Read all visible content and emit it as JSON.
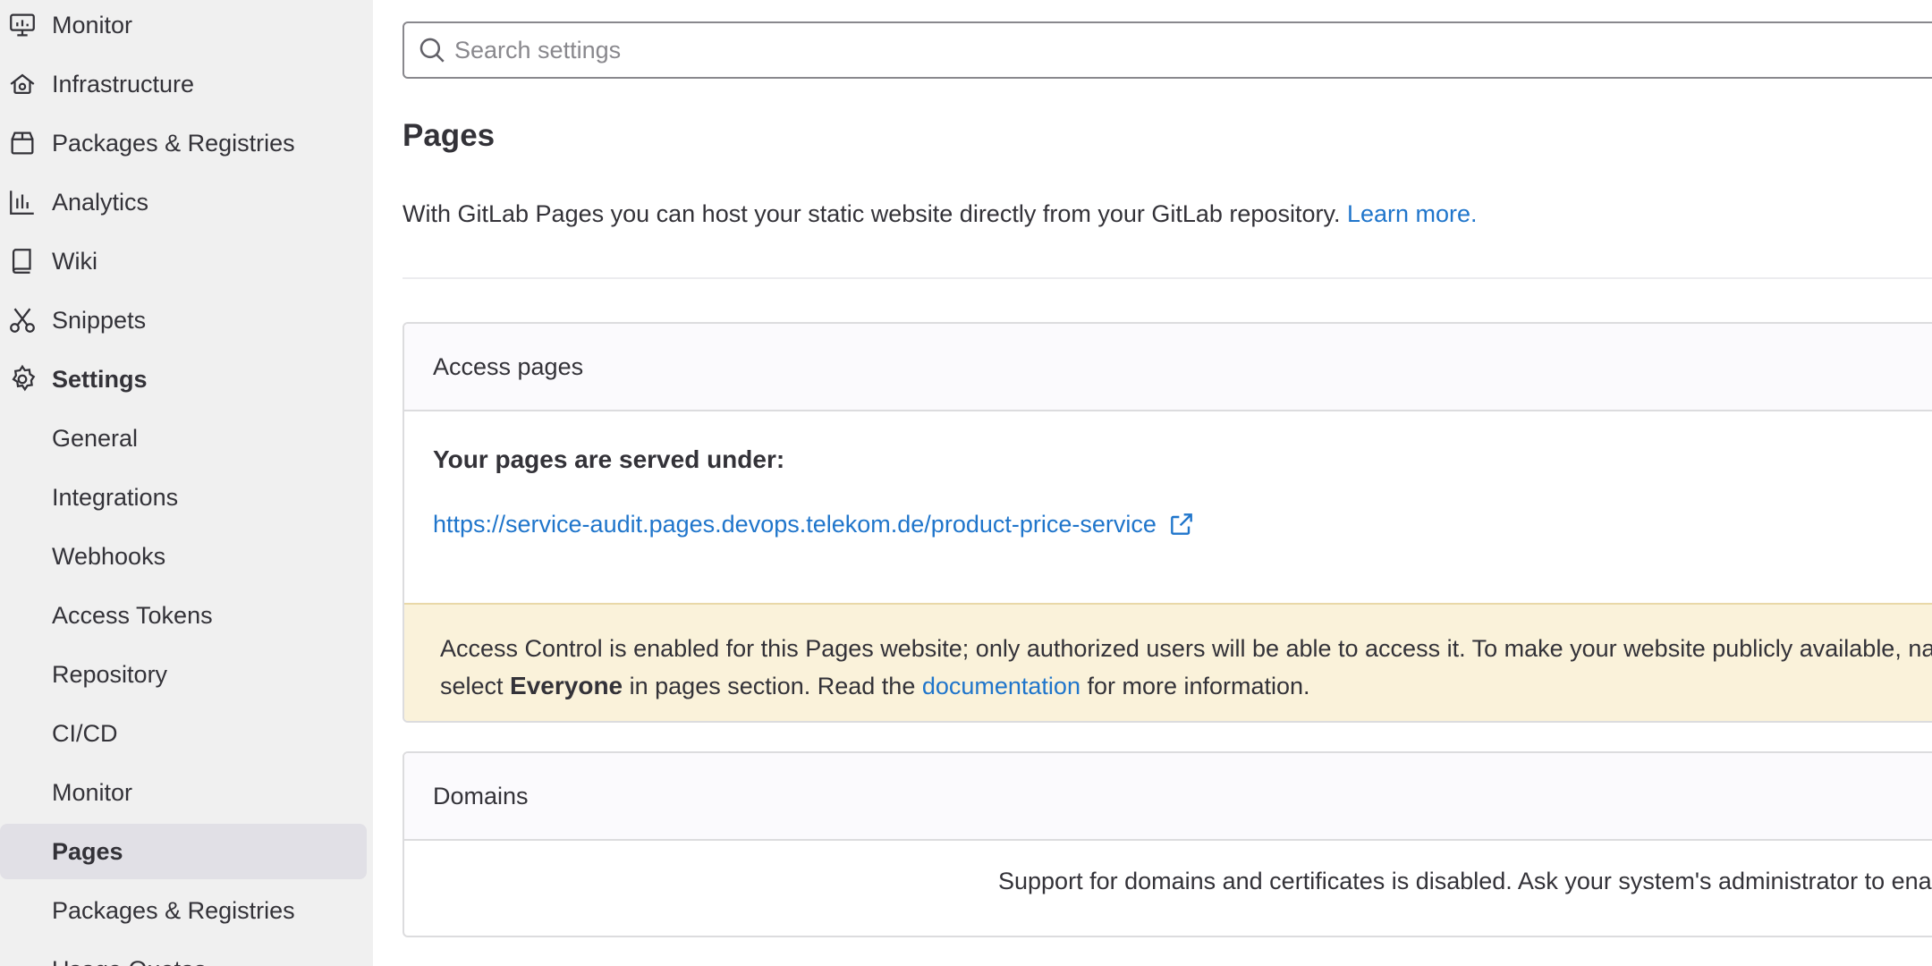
{
  "sidebar": {
    "items": [
      {
        "label": "Monitor",
        "icon": "monitor-icon",
        "top": 0
      },
      {
        "label": "Infrastructure",
        "icon": "infrastructure-icon"
      },
      {
        "label": "Packages & Registries",
        "icon": "package-icon"
      },
      {
        "label": "Analytics",
        "icon": "chart-icon"
      },
      {
        "label": "Wiki",
        "icon": "book-icon"
      },
      {
        "label": "Snippets",
        "icon": "scissors-icon"
      },
      {
        "label": "Settings",
        "icon": "gear-icon"
      }
    ],
    "sub_items": [
      {
        "label": "General"
      },
      {
        "label": "Integrations"
      },
      {
        "label": "Webhooks"
      },
      {
        "label": "Access Tokens"
      },
      {
        "label": "Repository"
      },
      {
        "label": "CI/CD"
      },
      {
        "label": "Monitor"
      },
      {
        "label": "Pages"
      },
      {
        "label": "Packages & Registries"
      },
      {
        "label": "Usage Quotas"
      }
    ],
    "active_item": "Pages"
  },
  "search": {
    "placeholder": "Search settings",
    "value": ""
  },
  "main": {
    "title": "Pages",
    "intro_text": "With GitLab Pages you can host your static website directly from your GitLab repository. ",
    "learn_more": "Learn more.",
    "access_card": {
      "header": "Access pages",
      "served_title": "Your pages are served under:",
      "url": "https://service-audit.pages.devops.telekom.de/product-price-service",
      "alert_line1": "Access Control is enabled for this Pages website; only authorized users will be able to access it. To make your website publicly available, navigate to y",
      "alert_line2_pre": "select ",
      "alert_line2_strong": "Everyone",
      "alert_line2_mid": " in pages section. Read the ",
      "alert_line2_link": "documentation",
      "alert_line2_post": " for more information."
    },
    "domains_card": {
      "header": "Domains",
      "body": "Support for domains and certificates is disabled. Ask your system's administrator to enable it."
    }
  },
  "colors": {
    "sidebar_bg": "#f0f0f0",
    "active_bg": "#e1e0e6",
    "link": "#1f75cb",
    "alert_bg": "#faf2da",
    "text": "#333238"
  }
}
